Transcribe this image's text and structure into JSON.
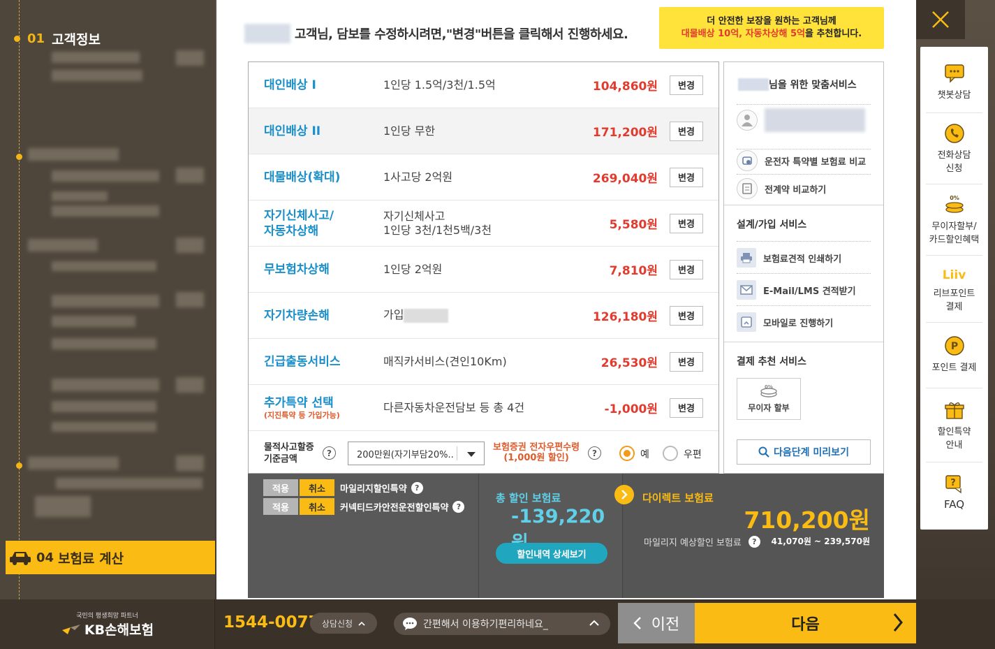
{
  "sidebar": {
    "step1_num": "01",
    "step1_label": "고객정보",
    "step4_num": "04",
    "step4_label": "보험료 계산"
  },
  "headline": "고객님, 담보를 수정하시려면,\"변경\"버튼을 클릭해서 진행하세요.",
  "promo": {
    "line1": "더 안전한 보장을 원하는 고객님께",
    "line2_red": "대물배상 10억, 자동차상해 5억",
    "line2_rest": "을 추천합니다."
  },
  "coverages": [
    {
      "name": "대인배상 I",
      "desc": "1인당 1.5억/3천/1.5억",
      "price": "104,860원"
    },
    {
      "name": "대인배상 II",
      "desc": "1인당 무한",
      "price": "171,200원"
    },
    {
      "name": "대물배상(확대)",
      "desc": "1사고당 2억원",
      "price": "269,040원"
    },
    {
      "name_l1": "자기신체사고/",
      "name_l2": "자동차상해",
      "desc_l1": "자기신체사고",
      "desc_l2": "1인당 3천/1천5백/3천",
      "price": "5,580원"
    },
    {
      "name": "무보험차상해",
      "desc": "1인당 2억원",
      "price": "7,810원"
    },
    {
      "name": "자기차량손해",
      "desc": "가입",
      "price": "126,180원"
    },
    {
      "name": "긴급출동서비스",
      "desc": "매직카서비스(견인10Km)",
      "price": "26,530원"
    },
    {
      "name": "추가특약 선택",
      "sub": "(지진특약 등 가입가능)",
      "desc": "다른자동차운전담보 등 총 4건",
      "price": "-1,000원"
    }
  ],
  "change_label": "변경",
  "property_threshold": {
    "label_l1": "물적사고할증",
    "label_l2": "기준금액",
    "selected": "200만원(자기부담20%..",
    "epost_l1": "보험증권 전자우편수령",
    "epost_l2": "(1,000원 할인)",
    "opt_yes": "예",
    "opt_mail": "우편"
  },
  "custom": {
    "title_suffix": "님을 위한 맞춤서비스",
    "compare_driver": "운전자 특약별 보험료 비교",
    "compare_prev": "전계약 비교하기",
    "design_title": "설계/가입 서비스",
    "print": "보험료견적 인쇄하기",
    "email": "E-Mail/LMS 견적받기",
    "mobile": "모바일로 진행하기",
    "pay_title": "결제 추천 서비스",
    "bnpl": "무이자 할부",
    "bnpl_badge": "0%",
    "next_preview": "다음단계 미리보기"
  },
  "discounts": [
    {
      "apply": "적용",
      "cancel": "취소",
      "label": "마일리지할인특약"
    },
    {
      "apply": "적용",
      "cancel": "취소",
      "label": "커넥티드카안전운전할인특약"
    }
  ],
  "summary": {
    "total_disc_label": "총 할인 보험료",
    "total_disc_value": "-139,220원",
    "detail_btn": "할인내역 상세보기",
    "direct_label": "다이렉트 보험료",
    "direct_value": "710,200원",
    "mileage_label": "마일리지 예상할인 보험료",
    "mileage_range": "41,070원 ~ 239,570원"
  },
  "quick": {
    "chatbot": "챗봇상담",
    "call_l1": "전화상담",
    "call_l2": "신청",
    "card_badge": "0%",
    "card_l1": "무이자할부/",
    "card_l2": "카드할인혜택",
    "liiv_logo": "Liiv",
    "liiv_l1": "리브포인트",
    "liiv_l2": "결제",
    "point_glyph": "P",
    "point": "포인트 결제",
    "disc_l1": "할인특약",
    "disc_l2": "안내",
    "faq": "FAQ"
  },
  "footer": {
    "tagline": "국민의 평생희망 파트너",
    "brand": "KB손해보험",
    "phone": "1544-0077",
    "consult": "상담신청",
    "chat": "간편해서 이용하기편리하네요_",
    "prev": "이전",
    "next": "다음"
  },
  "colors": {
    "accent": "#f9bb14",
    "blue": "#1a8fc9",
    "red": "#e23b2e",
    "teal": "#5fd0e8"
  }
}
